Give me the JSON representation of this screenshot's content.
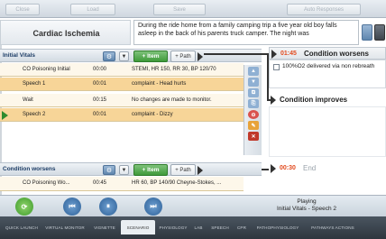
{
  "toolbar": {
    "buttons": [
      "Close",
      "Load",
      "Save",
      "Auto Responses"
    ]
  },
  "scenario": {
    "title": "Cardiac Ischemia",
    "description": "During the ride home from a family camping trip a five year old boy falls asleep in the back of his parents truck camper. The night was"
  },
  "phases": [
    {
      "name": "Initial Vitals",
      "item_label": "+ Item",
      "path_label": "+ Path",
      "items": [
        {
          "name": "CO Poisoning Initial",
          "time": "00:00",
          "detail": "STEMI, HR 150, RR 30, BP 120/70"
        },
        {
          "name": "Speech 1",
          "time": "00:01",
          "detail": "complaint - Head hurts"
        },
        {
          "name": "Wait",
          "time": "00:15",
          "detail": "No changes are made to monitor."
        },
        {
          "name": "Speech 2",
          "time": "00:01",
          "detail": "complaint - Dizzy"
        }
      ]
    },
    {
      "name": "Condition worsens",
      "item_label": "+ Item",
      "path_label": "+ Path",
      "items": [
        {
          "name": "CO Poisoning Wo...",
          "time": "00:45",
          "detail": "HR 60, BP 140/90 Cheyne-Stokes, ..."
        }
      ]
    }
  ],
  "paths": [
    {
      "time": "01:45",
      "name": "Condition worsens",
      "checkbox_label": "100%O2 delivered via non rebreath"
    },
    {
      "time": "",
      "name": "Condition improves"
    },
    {
      "time": "00:30",
      "name": "End"
    }
  ],
  "status": {
    "line1": "Playing",
    "line2": "Initial Vitals - Speech 2"
  },
  "tabs": [
    "QUICK LAUNCH",
    "VIRTUAL MONITOR",
    "VIGNETTE",
    "SCENARIO",
    "PHYSIOLOGY",
    "LAB",
    "SPEECH",
    "CPR",
    "PATHOPHYSIOLOGY",
    "PATHWAYS ACTIONS"
  ],
  "colors": {
    "accent_green": "#3f9a3a",
    "path_time": "#e24a1e",
    "row_orange": "#f7d598",
    "row_white": "#fdf7ea"
  }
}
